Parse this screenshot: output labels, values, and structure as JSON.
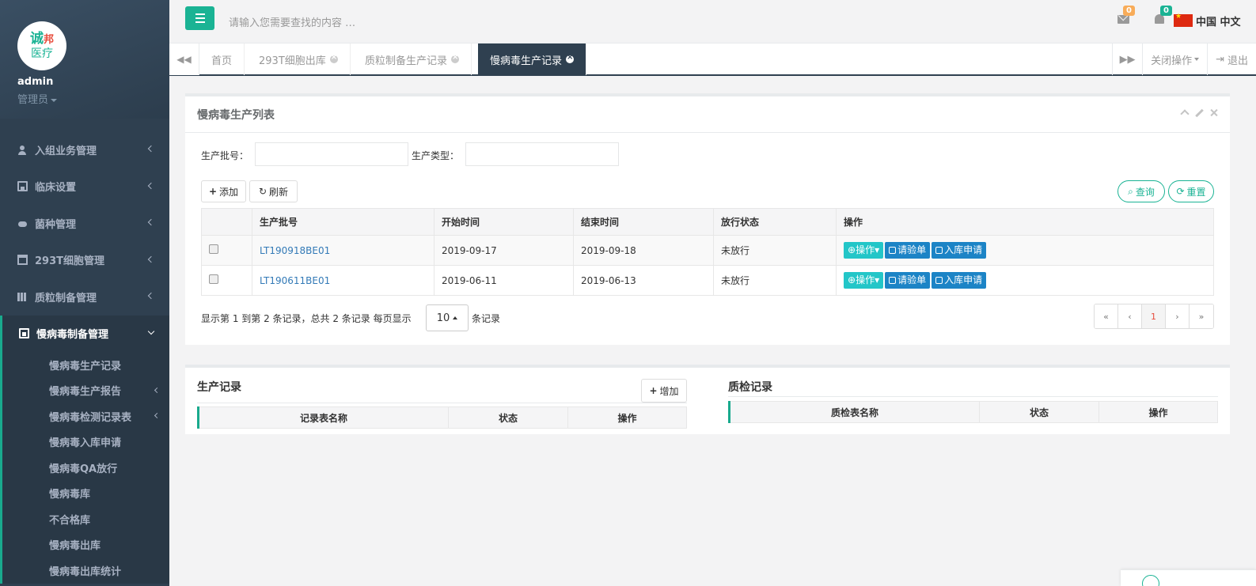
{
  "user": {
    "name": "admin",
    "role": "管理员",
    "logo_line1": "诚",
    "logo_line1b": "邦",
    "logo_line2": "医疗"
  },
  "sidebar": {
    "items": [
      {
        "label": "入组业务管理",
        "icon": "user-icon"
      },
      {
        "label": "临床设置",
        "icon": "save-icon"
      },
      {
        "label": "菌种管理",
        "icon": "paw-icon"
      },
      {
        "label": "293T细胞管理",
        "icon": "calendar-icon"
      },
      {
        "label": "质粒制备管理",
        "icon": "map-icon"
      },
      {
        "label": "慢病毒制备管理",
        "icon": "clipboard-icon"
      }
    ],
    "subitems": [
      {
        "label": "慢病毒生产记录"
      },
      {
        "label": "慢病毒生产报告"
      },
      {
        "label": "慢病毒检测记录表"
      },
      {
        "label": "慢病毒入库申请"
      },
      {
        "label": "慢病毒QA放行"
      },
      {
        "label": "慢病毒库"
      },
      {
        "label": "不合格库"
      },
      {
        "label": "慢病毒出库"
      },
      {
        "label": "慢病毒出库统计"
      }
    ]
  },
  "topbar": {
    "search_placeholder": "请输入您需要查找的内容 …",
    "mail_count": "0",
    "bell_count": "0",
    "language": "中国 中文"
  },
  "tabs": {
    "items": [
      "首页",
      "293T细胞出库",
      "质粒制备生产记录",
      "慢病毒生产记录"
    ],
    "close_ops": "关闭操作",
    "logout": "退出"
  },
  "list_panel": {
    "title": "慢病毒生产列表",
    "filter": {
      "batch_label": "生产批号：",
      "type_label": "生产类型："
    },
    "add_label": "添加",
    "refresh_label": "刷新",
    "query_label": "查询",
    "reset_label": "重置",
    "columns": [
      "",
      "生产批号",
      "开始时间",
      "结束时间",
      "放行状态",
      "操作"
    ],
    "rows": [
      {
        "batch": "LT190918BE01",
        "start": "2019-09-17",
        "end": "2019-09-18",
        "status": "未放行"
      },
      {
        "batch": "LT190611BE01",
        "start": "2019-06-11",
        "end": "2019-06-13",
        "status": "未放行"
      }
    ],
    "row_actions": {
      "op": "操作",
      "inspect": "请验单",
      "store": "入库申请"
    },
    "page_info": "显示第 1 到第 2 条记录，总共 2 条记录 每页显示",
    "page_size": "10",
    "page_size_suffix": "条记录",
    "pager": [
      "«",
      "‹",
      "1",
      "›",
      "»"
    ]
  },
  "records": {
    "prod_title": "生产记录",
    "add_label": "增加",
    "prod_columns": [
      "记录表名称",
      "状态",
      "操作"
    ],
    "qc_title": "质检记录",
    "qc_columns": [
      "质检表名称",
      "状态",
      "操作"
    ]
  },
  "colors": {
    "accent": "#1ab394",
    "sidebar": "#2f4050",
    "info": "#23c6c8",
    "primary": "#1c84c6"
  }
}
